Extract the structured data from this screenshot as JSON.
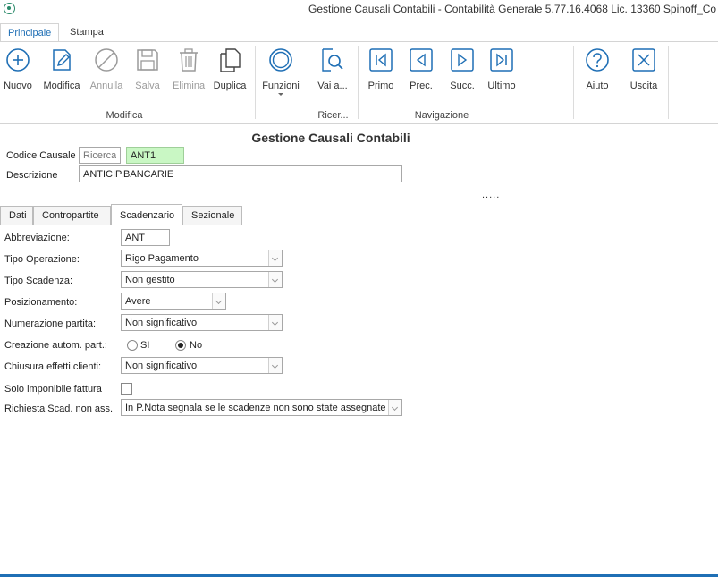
{
  "window": {
    "title": "Gestione Causali Contabili - Contabilità Generale 5.77.16.4068 Lic. 13360 Spinoff_Co"
  },
  "ribbon_tabs": [
    "Principale",
    "Stampa"
  ],
  "ribbon": {
    "buttons": {
      "nuovo": "Nuovo",
      "modifica": "Modifica",
      "annulla": "Annulla",
      "salva": "Salva",
      "elimina": "Elimina",
      "duplica": "Duplica",
      "funzioni": "Funzioni",
      "vai": "Vai a...",
      "primo": "Primo",
      "prec": "Prec.",
      "succ": "Succ.",
      "ultimo": "Ultimo",
      "aiuto": "Aiuto",
      "uscita": "Uscita"
    },
    "groups": {
      "modifica": "Modifica",
      "ricerca": "Ricer...",
      "navigazione": "Navigazione"
    }
  },
  "form": {
    "title": "Gestione Causali Contabili",
    "codice_label": "Codice Causale",
    "ricerca_placeholder": "Ricerca",
    "codice_value": "ANT1",
    "descrizione_label": "Descrizione",
    "descrizione_value": "ANTICIP.BANCARIE",
    "dots": "....."
  },
  "tabs": [
    "Dati",
    "Contropartite",
    "Scadenzario",
    "Sezionale"
  ],
  "scadenzario": {
    "abbreviazione_label": "Abbreviazione:",
    "abbreviazione_value": "ANT",
    "tipo_operazione_label": "Tipo Operazione:",
    "tipo_operazione_value": "Rigo Pagamento",
    "tipo_scadenza_label": "Tipo Scadenza:",
    "tipo_scadenza_value": "Non gestito",
    "posizionamento_label": "Posizionamento:",
    "posizionamento_value": "Avere",
    "numerazione_label": "Numerazione partita:",
    "numerazione_value": "Non significativo",
    "creazione_label": "Creazione autom. part.:",
    "creazione_si": "SI",
    "creazione_no": "No",
    "chiusura_label": "Chiusura effetti clienti:",
    "chiusura_value": "Non significativo",
    "solo_imponibile_label": "Solo imponibile fattura",
    "richiesta_label": "Richiesta Scad. non ass.",
    "richiesta_value": "In P.Nota segnala se le scadenze non sono state assegnate"
  }
}
